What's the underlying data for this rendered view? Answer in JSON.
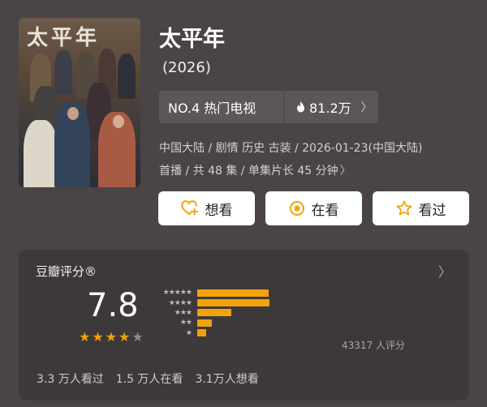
{
  "poster": {
    "title_art": "太平年"
  },
  "title": "太平年",
  "year": "(2026)",
  "rank": {
    "label": "NO.4 热门电视",
    "heat": "81.2万"
  },
  "meta": {
    "line1": "中国大陆 / 剧情 历史 古装 / 2026-01-23(中国大陆)",
    "line2": "首播 / 共 48 集 / 单集片长 45 分钟"
  },
  "actions": [
    {
      "label": "想看",
      "icon": "heart-plus-icon"
    },
    {
      "label": "在看",
      "icon": "target-icon"
    },
    {
      "label": "看过",
      "icon": "star-outline-icon"
    }
  ],
  "rating": {
    "title": "豆瓣评分®",
    "score": "7.8",
    "stars": 4,
    "count": "43317 人评分",
    "distribution": [
      {
        "stars": 5,
        "fraction": 0.5
      },
      {
        "stars": 4,
        "fraction": 0.51
      },
      {
        "stars": 3,
        "fraction": 0.24
      },
      {
        "stars": 2,
        "fraction": 0.1
      },
      {
        "stars": 1,
        "fraction": 0.06
      }
    ],
    "stats": [
      "3.3 万人看过",
      "1.5 万人在看",
      "3.1万人想看"
    ]
  },
  "colors": {
    "accent": "#f2a20c",
    "background": "#4a4446",
    "card": "#3d393a"
  }
}
